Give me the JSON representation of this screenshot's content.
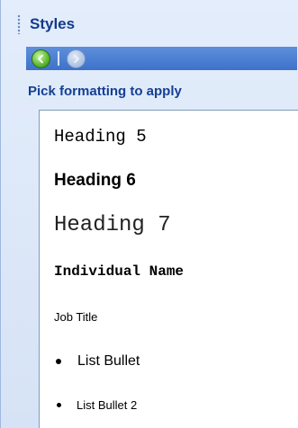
{
  "pane": {
    "title": "Styles",
    "subtitle": "Pick formatting to apply"
  },
  "toolbar": {
    "back_icon": "back-arrow-icon",
    "forward_icon": "forward-arrow-icon"
  },
  "styles": [
    {
      "label": "Heading 5"
    },
    {
      "label": "Heading 6"
    },
    {
      "label": "Heading 7"
    },
    {
      "label": "Individual Name"
    },
    {
      "label": "Job Title"
    },
    {
      "label": "List Bullet"
    },
    {
      "label": "List Bullet 2"
    }
  ],
  "colors": {
    "title": "#123a8a",
    "toolbar": "#3d72c9",
    "back_button": "#5cb830"
  }
}
